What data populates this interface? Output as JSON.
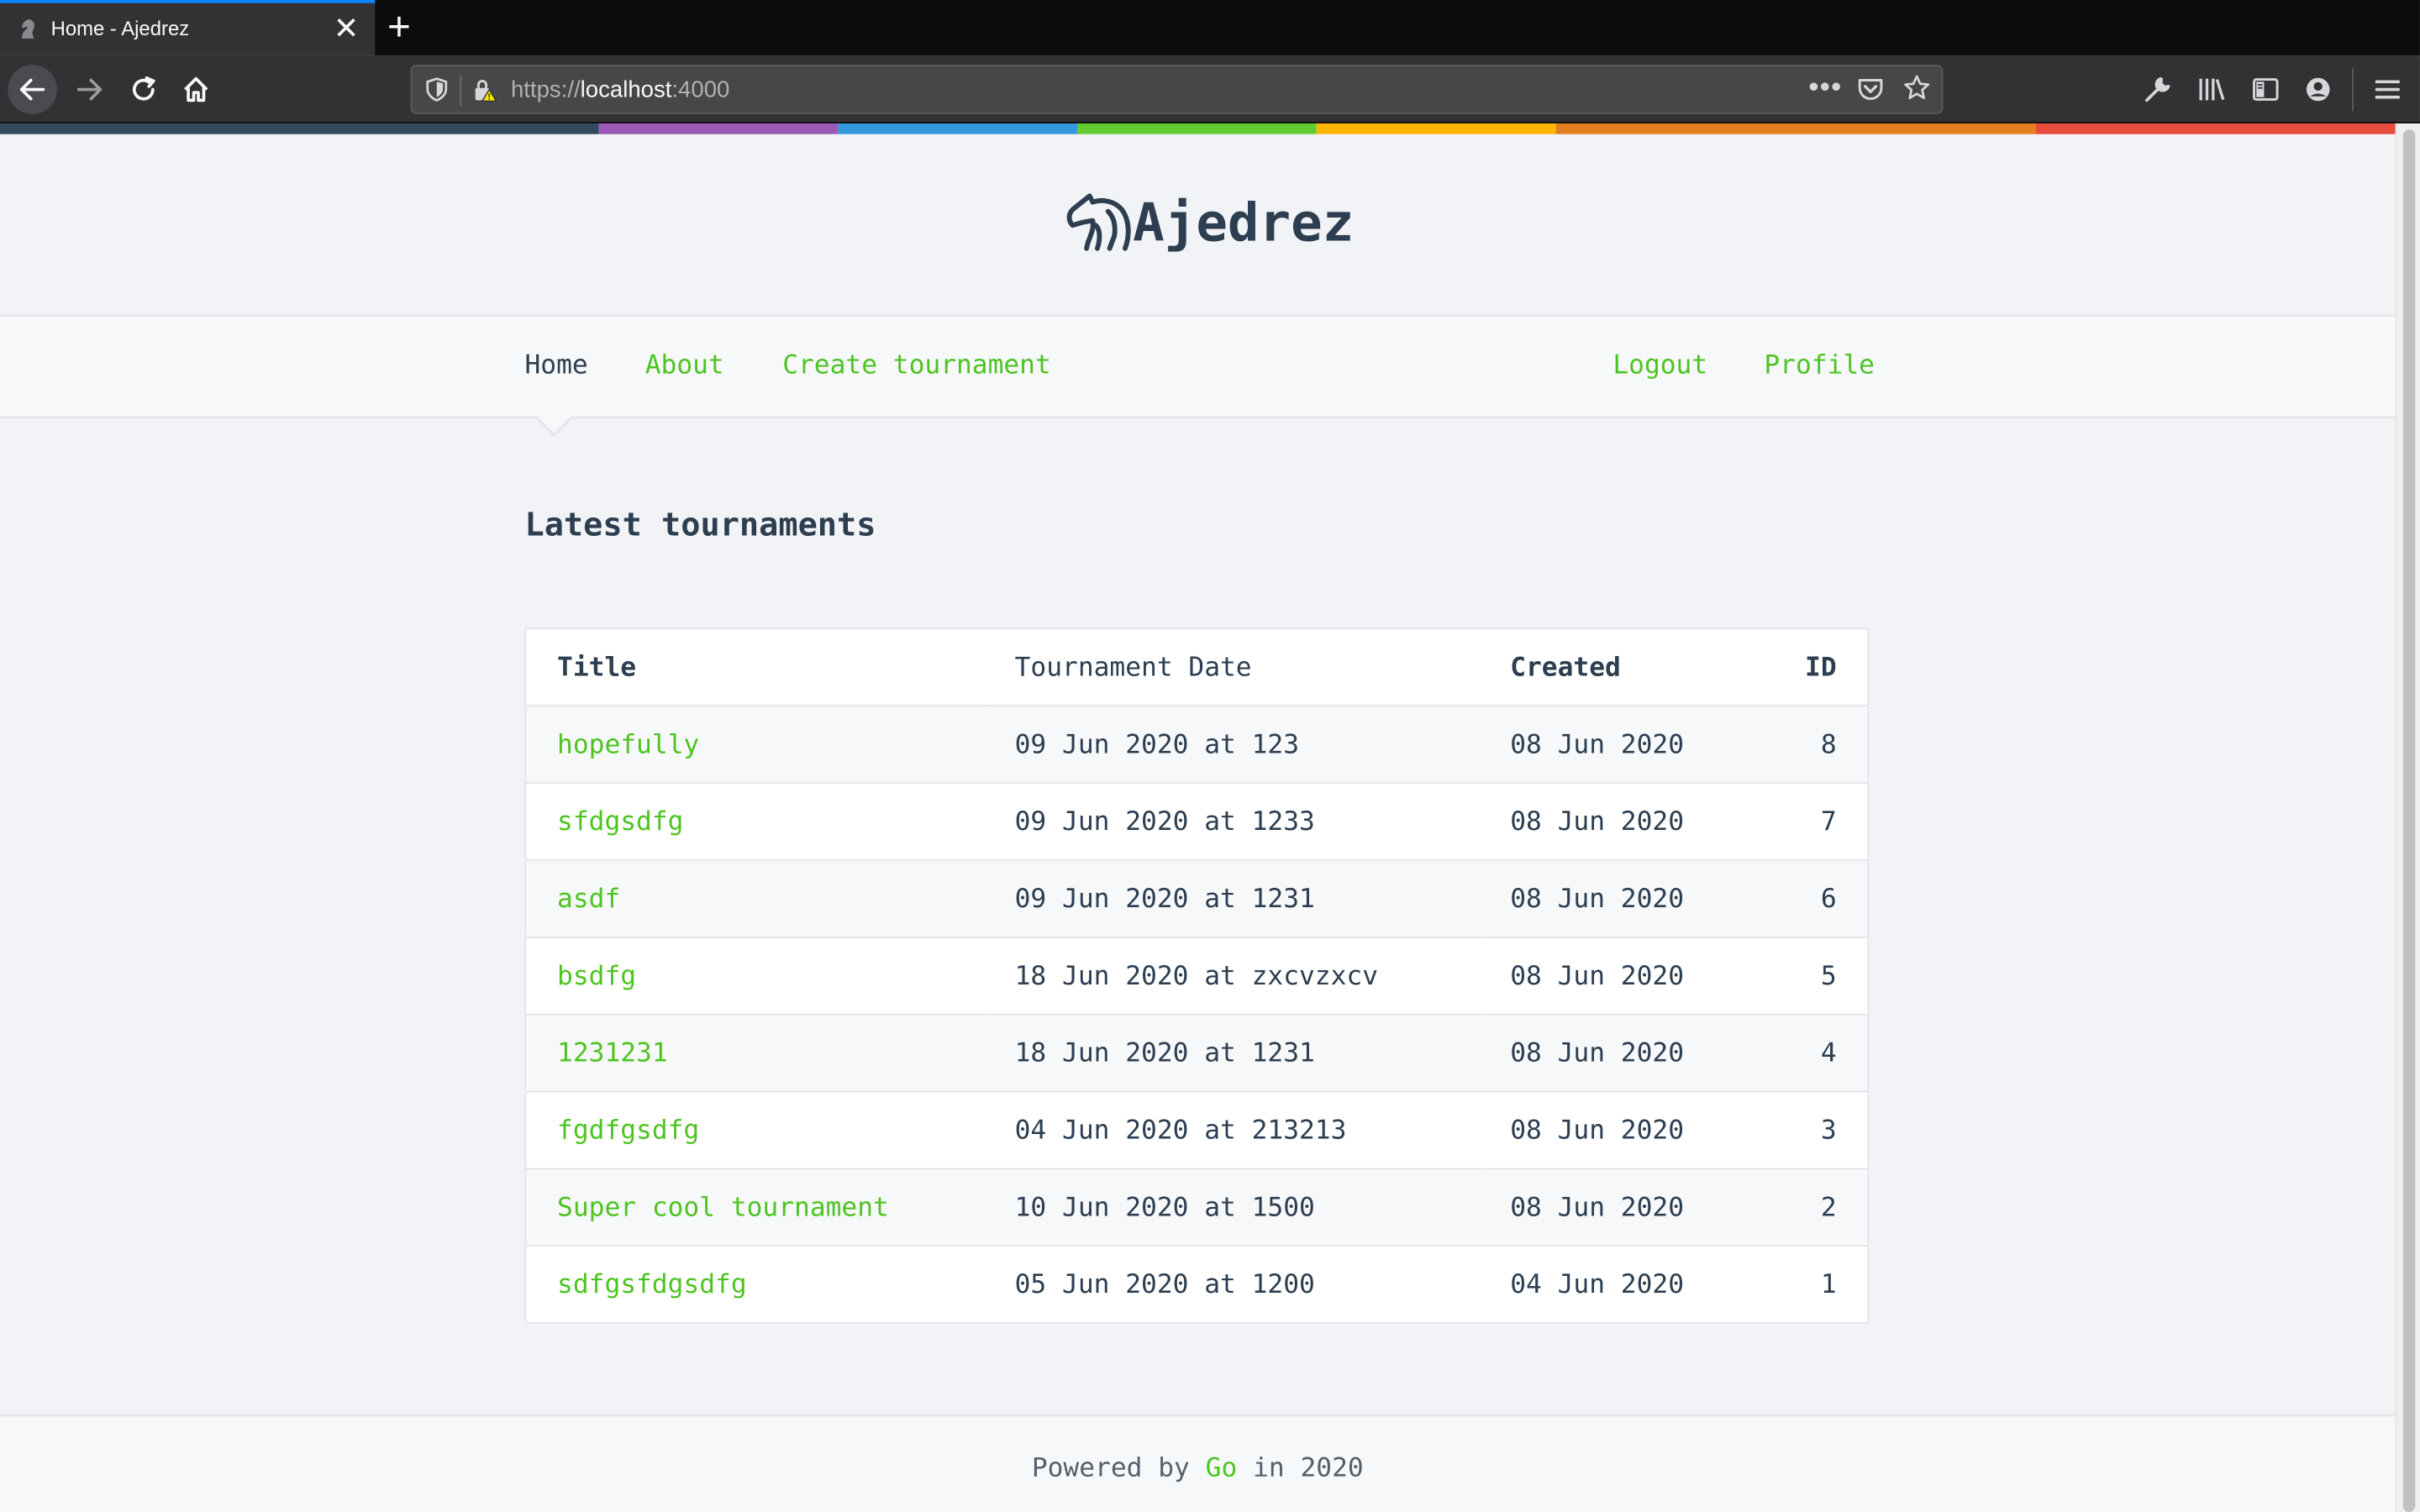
{
  "browser": {
    "tab_title": "Home - Ajedrez",
    "url_prefix": "https://",
    "url_host": "localhost",
    "url_port": ":4000"
  },
  "site": {
    "brand": "Ajedrez",
    "accent_color": "#4ec421",
    "text_color": "#2c3e50"
  },
  "nav": {
    "home": "Home",
    "about": "About",
    "create": "Create tournament",
    "logout": "Logout",
    "profile": "Profile"
  },
  "main": {
    "heading": "Latest tournaments",
    "columns": [
      "Title",
      "Tournament Date",
      "Created",
      "ID"
    ],
    "rows": [
      {
        "title": "hopefully",
        "date": "09 Jun 2020 at 123",
        "created": "08 Jun 2020",
        "id": "8"
      },
      {
        "title": "sfdgsdfg",
        "date": "09 Jun 2020 at 1233",
        "created": "08 Jun 2020",
        "id": "7"
      },
      {
        "title": "asdf",
        "date": "09 Jun 2020 at 1231",
        "created": "08 Jun 2020",
        "id": "6"
      },
      {
        "title": "bsdfg",
        "date": "18 Jun 2020 at zxcvzxcv",
        "created": "08 Jun 2020",
        "id": "5"
      },
      {
        "title": "1231231",
        "date": "18 Jun 2020 at 1231",
        "created": "08 Jun 2020",
        "id": "4"
      },
      {
        "title": "fgdfgsdfg",
        "date": "04 Jun 2020 at 213213",
        "created": "08 Jun 2020",
        "id": "3"
      },
      {
        "title": "Super cool tournament",
        "date": "10 Jun 2020 at 1500",
        "created": "08 Jun 2020",
        "id": "2"
      },
      {
        "title": "sdfgsfdgsdfg",
        "date": "05 Jun 2020 at 1200",
        "created": "04 Jun 2020",
        "id": "1"
      }
    ]
  },
  "footer": {
    "prefix": "Powered by",
    "link": "Go",
    "suffix": "in 2020"
  },
  "icons": {
    "tab_favicon": "chess-knight-icon",
    "logo": "chess-knight-icon"
  }
}
